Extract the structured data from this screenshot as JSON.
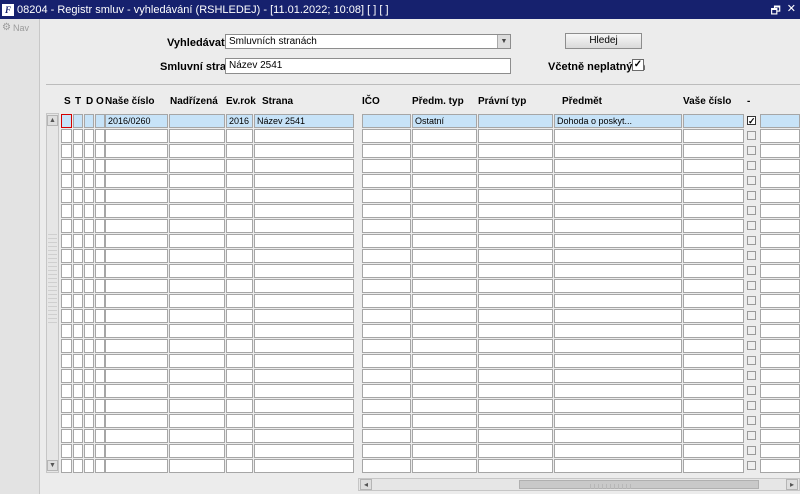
{
  "window": {
    "title": "08204 - Registr smluv - vyhledávání (RSHLEDEJ) - [11.01.2022; 10:08]  [ ]  [ ]",
    "restore_icon": "restore-icon",
    "close_icon": "close-icon"
  },
  "nav": {
    "label": "Nav"
  },
  "search": {
    "search_in_label": "Vyhledávat v",
    "search_in_value": "Smluvních stranách",
    "party_label": "Smluvní strana",
    "party_value": "Název 2541",
    "include_invalid_label": "Včetně neplatných",
    "include_invalid_checked": true,
    "search_button": "Hledej"
  },
  "table": {
    "columns": [
      "S",
      "T",
      "D",
      "O",
      "Naše číslo",
      "Nadřízená",
      "Ev.rok",
      "Strana",
      "IČO",
      "Předm. typ",
      "Právní typ",
      "Předmět",
      "Vaše číslo",
      "-"
    ],
    "rows": [
      {
        "nase_cislo": "2016/0260",
        "nadrizena": "",
        "ev_rok": "2016",
        "strana": "Název 2541",
        "ico": "",
        "predm_typ": "Ostatní",
        "pravni_typ": "",
        "predmet": "Dohoda o poskyt...",
        "vase_cislo": "",
        "checked": true
      }
    ],
    "empty_rows": 23
  }
}
